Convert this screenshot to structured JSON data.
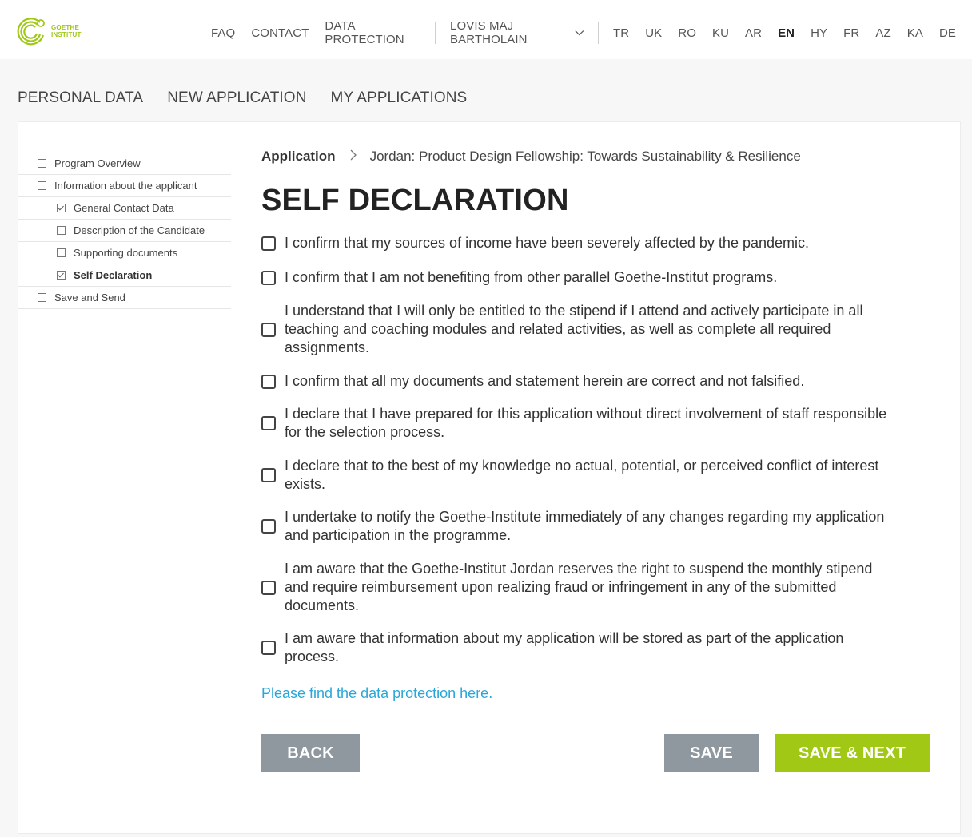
{
  "brand": {
    "name_line1": "GOETHE",
    "name_line2": "INSTITUT",
    "accent": "#a0c814"
  },
  "topnav": {
    "links": [
      "FAQ",
      "CONTACT",
      "DATA PROTECTION"
    ],
    "user": "LOVIS MAJ BARTHOLAIN",
    "languages": [
      "TR",
      "UK",
      "RO",
      "KU",
      "AR",
      "EN",
      "HY",
      "FR",
      "AZ",
      "KA",
      "DE"
    ],
    "active_language": "EN"
  },
  "tabs": [
    "PERSONAL DATA",
    "NEW APPLICATION",
    "MY APPLICATIONS"
  ],
  "sidebar": {
    "items": [
      {
        "label": "Program Overview",
        "level": 1,
        "checked": false,
        "bold": false
      },
      {
        "label": "Information about the applicant",
        "level": 1,
        "checked": false,
        "bold": false
      },
      {
        "label": "General Contact Data",
        "level": 2,
        "checked": true,
        "bold": false
      },
      {
        "label": "Description of the Candidate",
        "level": 2,
        "checked": false,
        "bold": false
      },
      {
        "label": "Supporting documents",
        "level": 2,
        "checked": false,
        "bold": false
      },
      {
        "label": "Self Declaration",
        "level": 2,
        "checked": true,
        "bold": true
      },
      {
        "label": "Save and Send",
        "level": 1,
        "checked": false,
        "bold": false
      }
    ]
  },
  "breadcrumb": {
    "root": "Application",
    "current": "Jordan: Product Design Fellowship: Towards Sustainability & Resilience"
  },
  "page_title": "SELF DECLARATION",
  "declarations": [
    {
      "lines": [
        "I confirm that my sources of income have been severely affected by the pandemic."
      ]
    },
    {
      "lines": [
        "I confirm that I am not benefiting from other parallel Goethe-Institut programs."
      ]
    },
    {
      "lines": [
        "I understand that I will only be entitled to the stipend if I attend and actively participate in all",
        "teaching and coaching modules and related activities, as well as complete all required",
        "assignments."
      ]
    },
    {
      "lines": [
        "I confirm that all my documents and statement herein are correct and not falsified."
      ]
    },
    {
      "lines": [
        "I declare that I have prepared for this application without direct involvement of staff responsible",
        "for the selection process."
      ]
    },
    {
      "lines": [
        "I declare that to the best of my knowledge no actual, potential, or perceived conflict of interest",
        "exists."
      ]
    },
    {
      "lines": [
        "I undertake to notify the Goethe-Institute immediately of any changes regarding my application",
        "and participation in the programme."
      ]
    },
    {
      "lines": [
        "I am aware that the Goethe-Institut Jordan reserves the right to suspend the monthly stipend",
        "and require reimbursement upon realizing fraud or infringement in any of the submitted",
        "documents."
      ]
    },
    {
      "lines": [
        "I am aware that information about my application will be stored as part of the application",
        "process."
      ]
    }
  ],
  "data_protection_link": "Please find the data protection here.",
  "buttons": {
    "back": "BACK",
    "save": "SAVE",
    "save_next": "SAVE & NEXT"
  }
}
